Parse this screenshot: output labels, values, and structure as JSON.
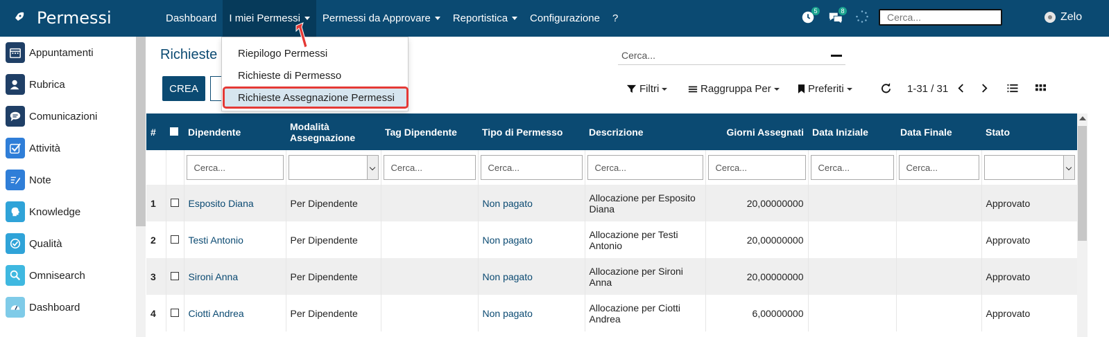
{
  "app": {
    "title": "Permessi"
  },
  "nav": {
    "items": [
      {
        "label": "Dashboard",
        "has_caret": false
      },
      {
        "label": "I miei Permessi",
        "has_caret": true
      },
      {
        "label": "Permessi da Approvare",
        "has_caret": true
      },
      {
        "label": "Reportistica",
        "has_caret": true
      },
      {
        "label": "Configurazione",
        "has_caret": false
      },
      {
        "label": "?",
        "has_caret": false
      }
    ],
    "activity_badge": "5",
    "messages_badge": "8",
    "search_placeholder": "Cerca...",
    "user_name": "Zelo"
  },
  "sidebar": {
    "items": [
      {
        "label": "Appuntamenti",
        "icon": "calendar-icon",
        "color": "#1f3f66"
      },
      {
        "label": "Rubrica",
        "icon": "contacts-icon",
        "color": "#1f3f66"
      },
      {
        "label": "Comunicazioni",
        "icon": "chat-icon",
        "color": "#1f3f66"
      },
      {
        "label": "Attività",
        "icon": "check-icon",
        "color": "#2f7ed8"
      },
      {
        "label": "Note",
        "icon": "note-icon",
        "color": "#2f7ed8"
      },
      {
        "label": "Knowledge",
        "icon": "brain-icon",
        "color": "#2fa3d8"
      },
      {
        "label": "Qualità",
        "icon": "quality-icon",
        "color": "#2fa3d8"
      },
      {
        "label": "Omnisearch",
        "icon": "magnifier-icon",
        "color": "#3fb8e0"
      },
      {
        "label": "Dashboard",
        "icon": "gauge-icon",
        "color": "#7fcbe8"
      }
    ]
  },
  "main": {
    "breadcrumb": "Richieste",
    "create_label": "CREA",
    "search_placeholder": "Cerca...",
    "filters_label": "Filtri",
    "group_label": "Raggruppa Per",
    "favorites_label": "Preferiti",
    "pager": "1-31 / 31"
  },
  "dropdown": {
    "items": [
      "Riepilogo Permessi",
      "Richieste di Permesso",
      "Richieste Assegnazione Permessi"
    ],
    "highlighted_index": 2
  },
  "table": {
    "columns": [
      "#",
      "",
      "Dipendente",
      "Modalità Assegnazione",
      "Tag Dipendente",
      "Tipo di Permesso",
      "Descrizione",
      "Giorni Assegnati",
      "Data Iniziale",
      "Data Finale",
      "Stato"
    ],
    "filter_placeholder": "Cerca...",
    "rows": [
      {
        "n": "1",
        "dipendente": "Esposito Diana",
        "modalita": "Per Dipendente",
        "tag": "",
        "tipo": "Non pagato",
        "descrizione": "Allocazione per Esposito Diana",
        "giorni": "20,00000000",
        "data_iniziale": "",
        "data_finale": "",
        "stato": "Approvato"
      },
      {
        "n": "2",
        "dipendente": "Testi Antonio",
        "modalita": "Per Dipendente",
        "tag": "",
        "tipo": "Non pagato",
        "descrizione": "Allocazione per Testi Antonio",
        "giorni": "20,00000000",
        "data_iniziale": "",
        "data_finale": "",
        "stato": "Approvato"
      },
      {
        "n": "3",
        "dipendente": "Sironi Anna",
        "modalita": "Per Dipendente",
        "tag": "",
        "tipo": "Non pagato",
        "descrizione": "Allocazione per Sironi Anna",
        "giorni": "20,00000000",
        "data_iniziale": "",
        "data_finale": "",
        "stato": "Approvato"
      },
      {
        "n": "4",
        "dipendente": "Ciotti Andrea",
        "modalita": "Per Dipendente",
        "tag": "",
        "tipo": "Non pagato",
        "descrizione": "Allocazione per Ciotti Andrea",
        "giorni": "6,00000000",
        "data_iniziale": "",
        "data_finale": "",
        "stato": "Approvato"
      }
    ]
  },
  "colors": {
    "primary": "#0b4a72",
    "highlight_outline": "#e53935",
    "badge": "#1aa38f"
  }
}
